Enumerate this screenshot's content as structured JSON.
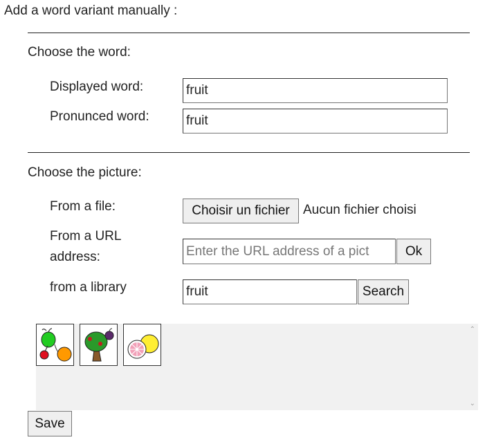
{
  "page": {
    "heading": "Add a word variant manually :"
  },
  "word_section": {
    "title": "Choose the word:",
    "displayed_label": "Displayed word:",
    "displayed_value": "fruit",
    "pronounced_label": "Pronunced word:",
    "pronounced_value": "fruit"
  },
  "picture_section": {
    "title": "Choose the picture:",
    "file_label": "From a file:",
    "file_button": "Choisir un fichier",
    "file_status": "Aucun fichier choisi",
    "url_label_line1": "From a URL",
    "url_label_line2": "address:",
    "url_placeholder": "Enter the URL address of a pict",
    "url_ok": "Ok",
    "library_label": "from a library",
    "library_value": "fruit",
    "search_button": "Search"
  },
  "gallery": {
    "thumbnails": [
      {
        "icon": "fruits-apple-cherry-orange-icon"
      },
      {
        "icon": "fruit-tree-plum-icon"
      },
      {
        "icon": "citrus-slices-icon"
      }
    ],
    "scroll_up": "⌃",
    "scroll_down": "⌄"
  },
  "actions": {
    "save": "Save"
  }
}
